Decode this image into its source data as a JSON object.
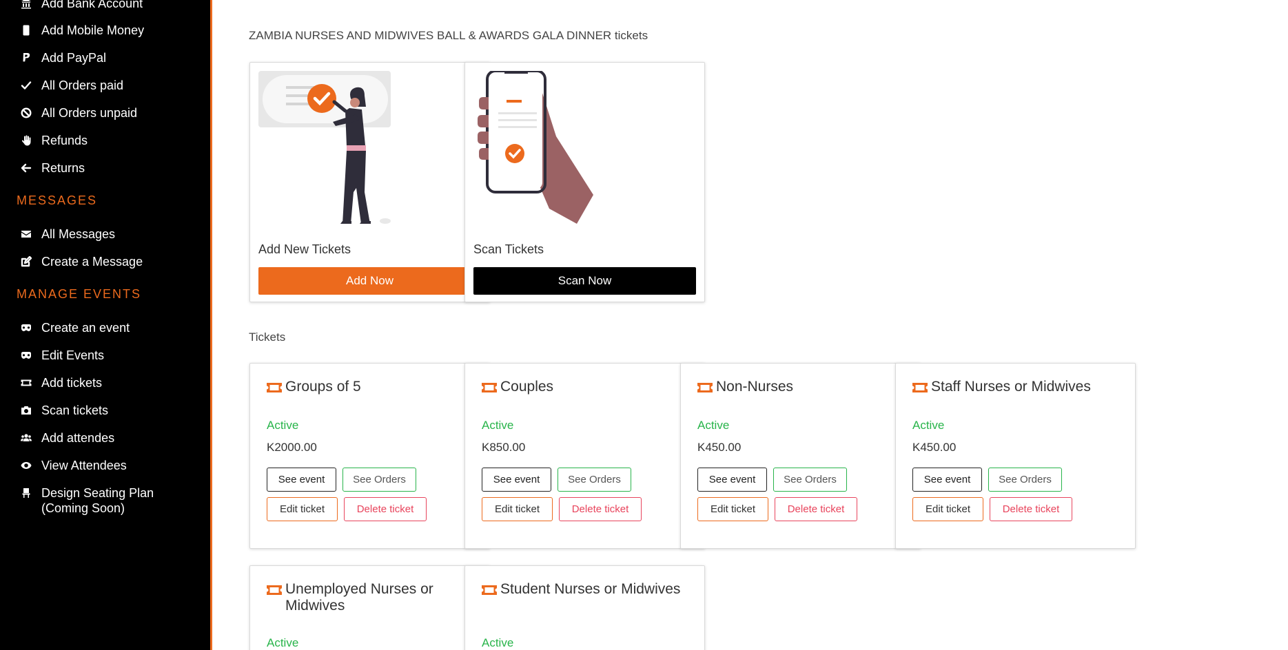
{
  "sidebar": {
    "items_top": [
      {
        "label": "Add Bank Account",
        "icon": "bank-icon"
      },
      {
        "label": "Add Mobile Money",
        "icon": "mobile-icon"
      },
      {
        "label": "Add PayPal",
        "icon": "paypal-icon"
      },
      {
        "label": "All Orders paid",
        "icon": "check-icon"
      },
      {
        "label": "All Orders unpaid",
        "icon": "ban-icon"
      },
      {
        "label": "Refunds",
        "icon": "hand-icon"
      },
      {
        "label": "Returns",
        "icon": "arrow-left-icon"
      }
    ],
    "messages_heading": "MESSAGES",
    "messages_items": [
      {
        "label": "All Messages",
        "icon": "envelope-icon"
      },
      {
        "label": "Create a Message",
        "icon": "edit-icon"
      }
    ],
    "events_heading": "MANAGE EVENTS",
    "events_items": [
      {
        "label": "Create an event",
        "icon": "mask-icon"
      },
      {
        "label": "Edit Events",
        "icon": "mask-icon"
      },
      {
        "label": "Add tickets",
        "icon": "ticket-icon"
      },
      {
        "label": "Scan tickets",
        "icon": "camera-icon"
      },
      {
        "label": "Add attendes",
        "icon": "users-icon"
      },
      {
        "label": "View Attendees",
        "icon": "eye-icon"
      },
      {
        "label": "Design Seating Plan (Coming Soon)",
        "icon": "chair-icon"
      }
    ]
  },
  "main": {
    "heading": "ZAMBIA NURSES AND MIDWIVES BALL & AWARDS GALA DINNER tickets",
    "actions": [
      {
        "title": "Add New Tickets",
        "button": "Add Now"
      },
      {
        "title": "Scan Tickets",
        "button": "Scan Now"
      }
    ],
    "tickets_heading": "Tickets",
    "tickets": [
      {
        "name": "Groups of 5",
        "status": "Active",
        "price": "K2000.00"
      },
      {
        "name": "Couples",
        "status": "Active",
        "price": "K850.00"
      },
      {
        "name": "Non-Nurses",
        "status": "Active",
        "price": "K450.00"
      },
      {
        "name": "Staff Nurses or Midwives",
        "status": "Active",
        "price": "K450.00"
      },
      {
        "name": "Unemployed Nurses or Midwives",
        "status": "Active"
      },
      {
        "name": "Student Nurses or Midwives",
        "status": "Active"
      }
    ],
    "ticket_buttons": {
      "see_event": "See event",
      "see_orders": "See Orders",
      "edit_ticket": "Edit ticket",
      "delete_ticket": "Delete ticket"
    }
  },
  "colors": {
    "accent": "#ec6a1d",
    "sidebar_bg": "#000000",
    "active_status": "#28b44a",
    "delete": "#e8445c"
  }
}
